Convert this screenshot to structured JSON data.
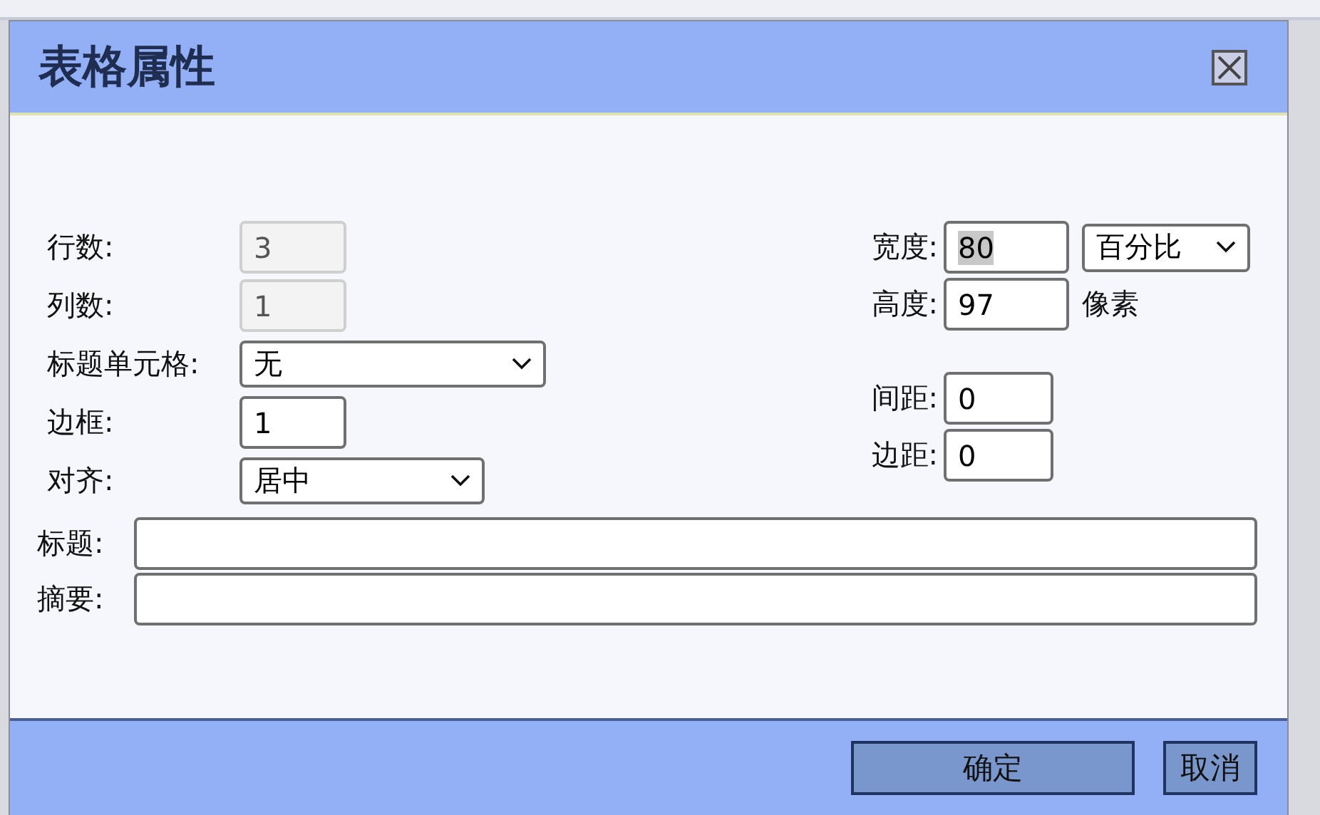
{
  "dialog": {
    "title": "表格属性",
    "left_fields": [
      {
        "label": "行数:",
        "kind": "input",
        "value": "3",
        "disabled": true
      },
      {
        "label": "列数:",
        "kind": "input",
        "value": "1",
        "disabled": true
      },
      {
        "label": "标题单元格:",
        "kind": "select",
        "value": "无",
        "disabled": false
      },
      {
        "label": "边框:",
        "kind": "input",
        "value": "1",
        "disabled": false
      },
      {
        "label": "对齐:",
        "kind": "select",
        "value": "居中",
        "disabled": false
      }
    ],
    "right_groups": [
      [
        {
          "label": "宽度:",
          "value": "80",
          "highlighted": true,
          "unit": "百分比",
          "kind": "with_select"
        },
        {
          "label": "高度:",
          "value": "97",
          "highlighted": false,
          "unit": "像素",
          "kind": "with_unit"
        }
      ],
      [
        {
          "label": "间距:",
          "value": "0",
          "highlighted": false,
          "kind": "plain"
        },
        {
          "label": "边距:",
          "value": "0",
          "highlighted": false,
          "kind": "plain"
        }
      ]
    ],
    "wide_fields": [
      {
        "label": "标题:"
      },
      {
        "label": "摘要:"
      }
    ],
    "buttons": [
      {
        "label": "确定",
        "kind": "primary"
      },
      {
        "label": "取消",
        "kind": "secondary"
      }
    ]
  }
}
